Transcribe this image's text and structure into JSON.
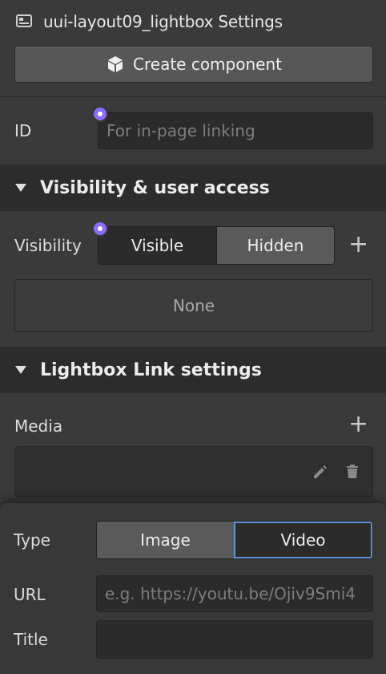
{
  "header": {
    "title": "uui-layout09_lightbox Settings",
    "icon": "component-settings-icon"
  },
  "create_component": {
    "label": "Create component",
    "icon": "cube-icon"
  },
  "id_field": {
    "label": "ID",
    "placeholder": "For in-page linking",
    "value": ""
  },
  "visibility_section": {
    "title": "Visibility & user access",
    "visibility_label": "Visibility",
    "options": [
      "Visible",
      "Hidden"
    ],
    "selected": "Visible",
    "conditions_value": "None"
  },
  "lightbox_section": {
    "title": "Lightbox Link settings",
    "media_label": "Media"
  },
  "popover": {
    "type_label": "Type",
    "type_options": [
      "Image",
      "Video"
    ],
    "type_selected": "Video",
    "url_label": "URL",
    "url_placeholder": "e.g. https://youtu.be/Ojiv9Smi4",
    "title_label": "Title",
    "title_value": ""
  },
  "colors": {
    "background": "#3a3a3a",
    "section_header": "#2c2c2c",
    "input_bg": "#2b2b2b",
    "accent_dot": "#8a6cff",
    "focus_border": "#5b8fd6"
  }
}
